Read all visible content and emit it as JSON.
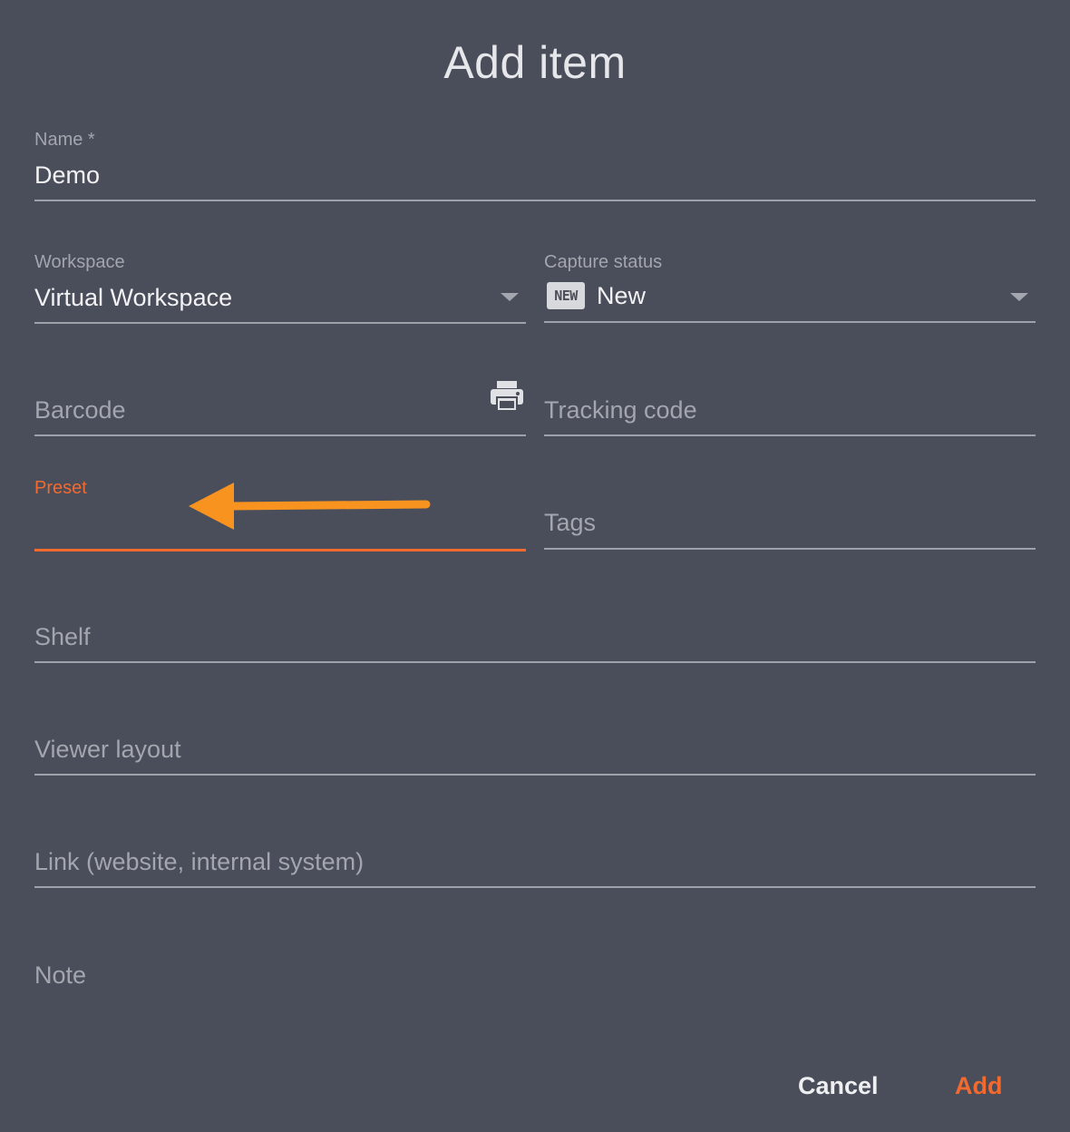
{
  "dialog": {
    "title": "Add item"
  },
  "fields": {
    "name": {
      "label": "Name *",
      "value": "Demo"
    },
    "workspace": {
      "label": "Workspace",
      "value": "Virtual Workspace"
    },
    "capture_status": {
      "label": "Capture status",
      "badge": "NEW",
      "value": "New"
    },
    "barcode": {
      "placeholder": "Barcode"
    },
    "tracking_code": {
      "placeholder": "Tracking code"
    },
    "preset": {
      "label": "Preset",
      "value": ""
    },
    "tags": {
      "placeholder": "Tags"
    },
    "shelf": {
      "placeholder": "Shelf"
    },
    "viewer_layout": {
      "placeholder": "Viewer layout"
    },
    "link": {
      "placeholder": "Link (website, internal system)"
    },
    "note": {
      "placeholder": "Note"
    }
  },
  "actions": {
    "cancel_label": "Cancel",
    "add_label": "Add"
  },
  "colors": {
    "background": "#4a4d5a",
    "accent": "#f26a2e",
    "annotation_arrow": "#f7931e",
    "underline": "#9ea1aa",
    "muted_text": "#a3a6ae"
  },
  "icons": {
    "barcode_print": "printer-icon",
    "dropdown": "chevron-down-icon",
    "annotation": "arrow-left-icon"
  }
}
